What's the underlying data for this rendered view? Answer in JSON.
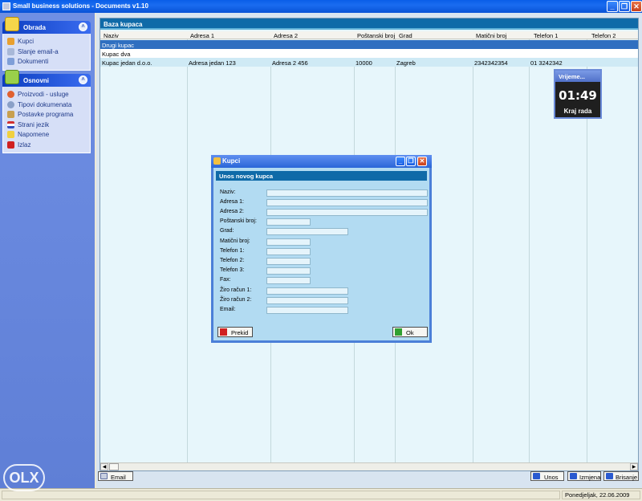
{
  "window": {
    "title": "Small business solutions - Documents v1.10",
    "min_icon": "minimize-icon",
    "max_icon": "maximize-icon",
    "close_icon": "close-icon"
  },
  "sidebar": {
    "groups": [
      {
        "title": "Obrada",
        "icon": "folder-open-icon",
        "items": [
          {
            "label": "Kupci",
            "icon": "user-icon"
          },
          {
            "label": "Slanje email-a",
            "icon": "email-icon"
          },
          {
            "label": "Dokumenti",
            "icon": "document-icon"
          }
        ]
      },
      {
        "title": "Osnovni",
        "icon": "folder-icon",
        "items": [
          {
            "label": "Proizvodi - usluge",
            "icon": "products-icon"
          },
          {
            "label": "Tipovi dokumenata",
            "icon": "search-icon"
          },
          {
            "label": "Postavke programa",
            "icon": "settings-icon"
          },
          {
            "label": "Strani jezik",
            "icon": "flag-icon"
          },
          {
            "label": "Napomene",
            "icon": "note-icon"
          },
          {
            "label": "Izlaz",
            "icon": "exit-icon"
          }
        ]
      }
    ]
  },
  "grid": {
    "title": "Baza kupaca",
    "columns": [
      "Naziv",
      "Adresa 1",
      "Adresa 2",
      "Poštanski broj",
      "Grad",
      "Matični broj",
      "Telefon 1",
      "Telefon 2"
    ],
    "rows": [
      [
        "Drugi kupac",
        "",
        "",
        "",
        "",
        "",
        "",
        ""
      ],
      [
        "Kupac dva",
        "",
        "",
        "",
        "",
        "",
        "",
        ""
      ],
      [
        "Kupac jedan d.o.o.",
        "Adresa jedan 123",
        "Adresa 2 456",
        "10000",
        "Zagreb",
        "2342342354",
        "01 3242342",
        ""
      ]
    ]
  },
  "clock": {
    "title": "Vrijeme...",
    "time": "01:49",
    "exit_label": "Kraj rada"
  },
  "dialog": {
    "title": "Kupci",
    "subtitle": "Unos novog kupca",
    "fields": [
      {
        "label": "Naziv:",
        "value": ""
      },
      {
        "label": "Adresa 1:",
        "value": ""
      },
      {
        "label": "Adresa 2:",
        "value": ""
      },
      {
        "label": "Poštanski broj:",
        "value": ""
      },
      {
        "label": "Grad:",
        "value": ""
      },
      {
        "label": "Matični broj:",
        "value": ""
      },
      {
        "label": "Telefon 1:",
        "value": ""
      },
      {
        "label": "Telefon 2:",
        "value": ""
      },
      {
        "label": "Telefon 3:",
        "value": ""
      },
      {
        "label": "Fax:",
        "value": ""
      },
      {
        "label": "Žiro račun 1:",
        "value": ""
      },
      {
        "label": "Žiro račun 2:",
        "value": ""
      },
      {
        "label": "Email:",
        "value": ""
      }
    ],
    "cancel_label": "Prekid",
    "ok_label": "Ok"
  },
  "toolbar": {
    "email_label": "Email",
    "unos_label": "Unos",
    "izmjena_label": "Izmjena",
    "brisanje_label": "Brisanje"
  },
  "status": {
    "date": "Ponedjeljak, 22.06.2009"
  },
  "watermark": "OLX",
  "colors": {
    "accent": "#0f6aa8",
    "selection": "#2f6fc0",
    "panel_bg": "#e7f6fb",
    "sidebar_bg": "#6f8fe4"
  }
}
